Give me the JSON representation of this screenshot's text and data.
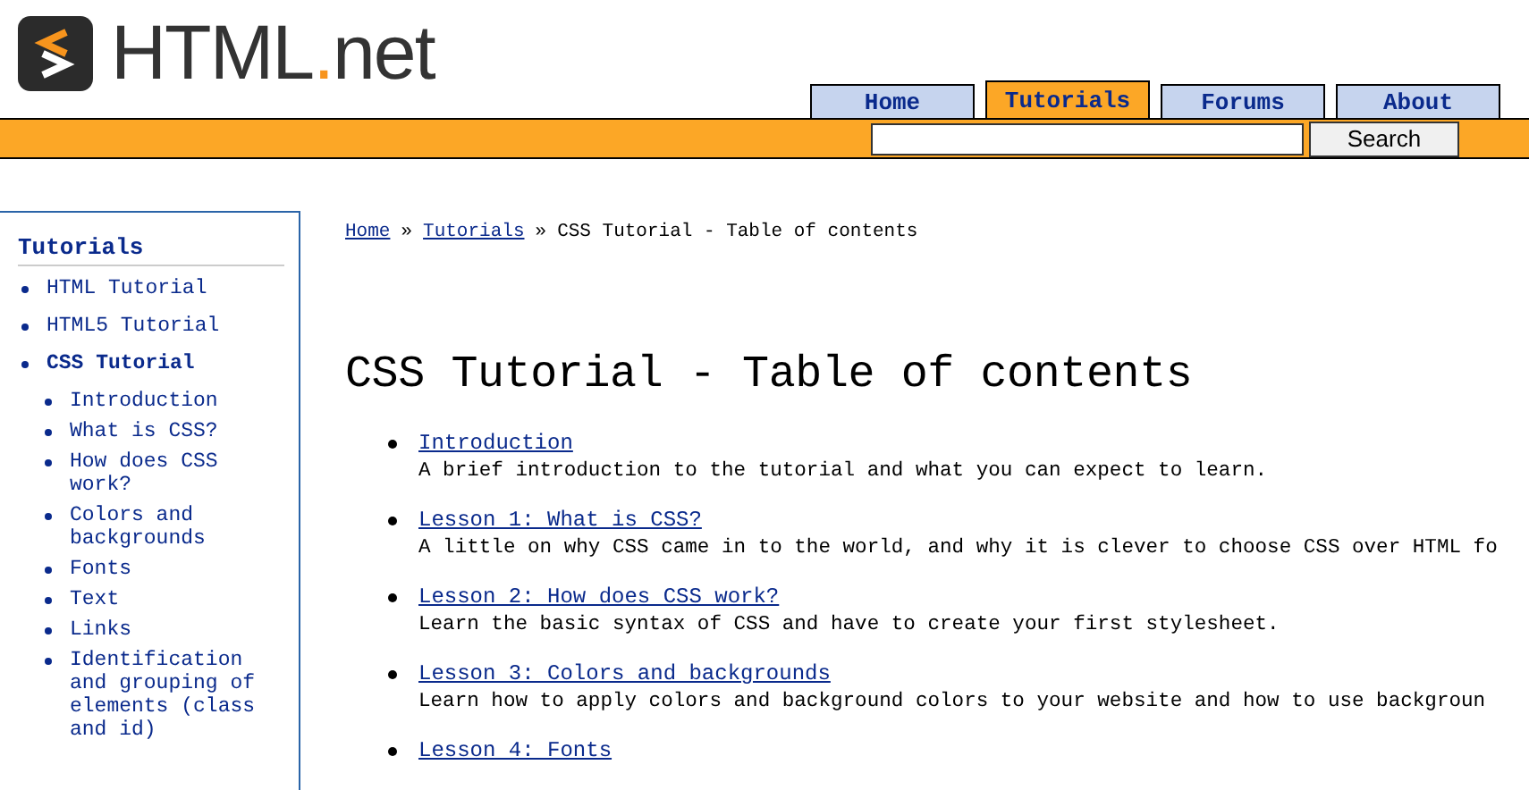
{
  "logo": {
    "name": "HTML",
    "dot": ".",
    "suffix": "net"
  },
  "nav_tabs": [
    {
      "label": "Home",
      "selected": false
    },
    {
      "label": "Tutorials",
      "selected": true
    },
    {
      "label": "Forums",
      "selected": false
    },
    {
      "label": "About",
      "selected": false
    }
  ],
  "search": {
    "button": "Search"
  },
  "sidebar": {
    "title": "Tutorials",
    "items": [
      {
        "label": "HTML Tutorial",
        "selected": false
      },
      {
        "label": "HTML5 Tutorial",
        "selected": false
      },
      {
        "label": "CSS Tutorial",
        "selected": true,
        "children": [
          {
            "label": "Introduction"
          },
          {
            "label": "What is CSS?"
          },
          {
            "label": "How does CSS work?"
          },
          {
            "label": "Colors and backgrounds"
          },
          {
            "label": "Fonts"
          },
          {
            "label": "Text"
          },
          {
            "label": "Links"
          },
          {
            "label": "Identification and grouping of elements (class and id)"
          }
        ]
      }
    ]
  },
  "breadcrumb": {
    "links": [
      "Home",
      "Tutorials"
    ],
    "separator": "»",
    "current": "CSS Tutorial - Table of contents"
  },
  "heading": "CSS Tutorial - Table of contents",
  "lessons": [
    {
      "title": "Introduction",
      "description": "A brief introduction to the tutorial and what you can expect to learn."
    },
    {
      "title": "Lesson 1: What is CSS?",
      "description": "A little on why CSS came in to the world, and why it is clever to choose CSS over HTML fo"
    },
    {
      "title": "Lesson 2: How does CSS work?",
      "description": "Learn the basic syntax of CSS and have to create your first stylesheet."
    },
    {
      "title": "Lesson 3: Colors and backgrounds",
      "description": "Learn how to apply colors and background colors to your website and how to use backgroun"
    },
    {
      "title": "Lesson 4: Fonts"
    }
  ]
}
